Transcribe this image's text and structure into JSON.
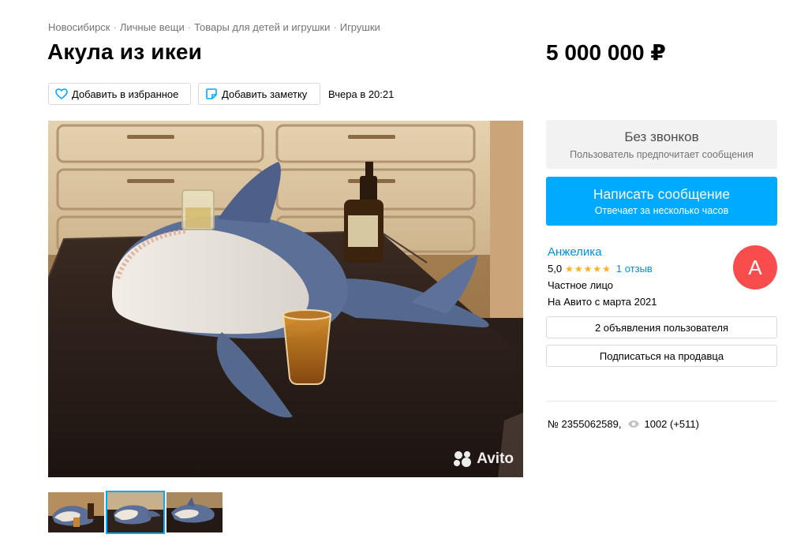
{
  "breadcrumb": [
    "Новосибирск",
    "Личные вещи",
    "Товары для детей и игрушки",
    "Игрушки"
  ],
  "listing": {
    "title": "Акула из икеи",
    "price": "5 000 000 ₽",
    "date": "Вчера в 20:21",
    "number": "№ 2355062589,",
    "views": "1002 (+511)"
  },
  "actions": {
    "favorite_label": "Добавить в избранное",
    "note_label": "Добавить заметку"
  },
  "contact": {
    "no_calls_title": "Без звонков",
    "no_calls_subtitle": "Пользователь предпочитает сообщения",
    "write_title": "Написать сообщение",
    "write_subtitle": "Отвечает за несколько часов"
  },
  "seller": {
    "name": "Анжелика",
    "rating": "5,0",
    "stars": "★★★★★",
    "reviews": "1 отзыв",
    "type": "Частное лицо",
    "since": "На Авито с марта 2021",
    "avatar_letter": "А",
    "ads_button": "2 объявления пользователя",
    "subscribe_button": "Подписаться на продавца"
  },
  "photo": {
    "watermark": "Avito",
    "thumbnails": 3,
    "active_thumbnail": 2
  },
  "colors": {
    "accent": "#00aaff",
    "link": "#0091d9",
    "avatar": "#f94d4d",
    "stars": "#ffb021"
  },
  "icons": [
    "heart-icon",
    "note-icon",
    "eye-icon",
    "avito-logo-icon"
  ]
}
